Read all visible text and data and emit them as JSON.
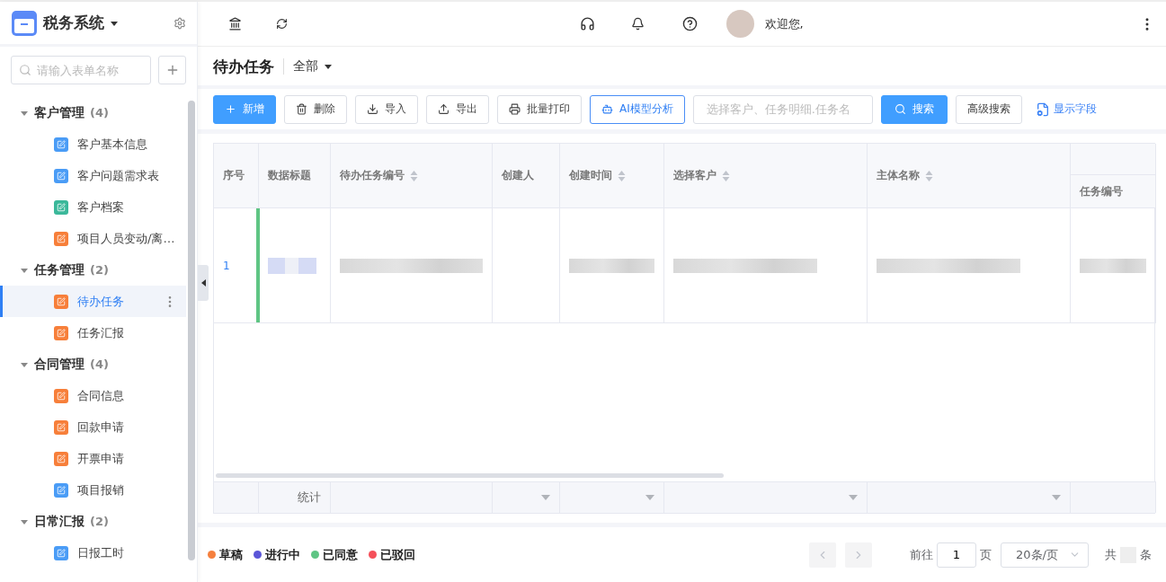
{
  "app": {
    "title": "税务系统"
  },
  "sidebar": {
    "search": {
      "placeholder": "请输入表单名称"
    },
    "groups": [
      {
        "label": "客户管理",
        "count": "(4)",
        "expanded": true,
        "children": [
          {
            "label": "客户基本信息",
            "color": "#4a9cf6",
            "selected": false
          },
          {
            "label": "客户问题需求表",
            "color": "#4a9cf6",
            "selected": false
          },
          {
            "label": "客户档案",
            "color": "#3bb89a",
            "selected": false
          },
          {
            "label": "项目人员变动/离…",
            "color": "#f77f3a",
            "selected": false
          }
        ]
      },
      {
        "label": "任务管理",
        "count": "(2)",
        "expanded": true,
        "children": [
          {
            "label": "待办任务",
            "color": "#f77f3a",
            "selected": true
          },
          {
            "label": "任务汇报",
            "color": "#f77f3a",
            "selected": false
          }
        ]
      },
      {
        "label": "合同管理",
        "count": "(4)",
        "expanded": true,
        "children": [
          {
            "label": "合同信息",
            "color": "#f77f3a",
            "selected": false
          },
          {
            "label": "回款申请",
            "color": "#f77f3a",
            "selected": false
          },
          {
            "label": "开票申请",
            "color": "#f77f3a",
            "selected": false
          },
          {
            "label": "项目报销",
            "color": "#4a9cf6",
            "selected": false
          }
        ]
      },
      {
        "label": "日常汇报",
        "count": "(2)",
        "expanded": true,
        "children": [
          {
            "label": "日报工时",
            "color": "#4a9cf6",
            "selected": false
          }
        ]
      }
    ]
  },
  "topbar": {
    "welcome": "欢迎您,"
  },
  "page": {
    "title": "待办任务",
    "filter": "全部"
  },
  "toolbar": {
    "buttons": [
      {
        "label": "新增",
        "kind": "primary"
      },
      {
        "label": "删除",
        "kind": "default"
      },
      {
        "label": "导入",
        "kind": "default"
      },
      {
        "label": "导出",
        "kind": "default"
      },
      {
        "label": "批量打印",
        "kind": "default"
      },
      {
        "label": "AI模型分析",
        "kind": "outline"
      }
    ],
    "search": {
      "placeholder": "选择客户、任务明细.任务名"
    },
    "search_button": "搜索",
    "advanced_button": "高级搜索",
    "fields_link": "显示字段"
  },
  "table": {
    "columns": [
      {
        "label": "序号",
        "sortable": false,
        "kind": "plain"
      },
      {
        "label": "数据标题",
        "sortable": false,
        "kind": "plain"
      },
      {
        "label": "待办任务编号",
        "sortable": true,
        "kind": "plain"
      },
      {
        "label": "创建人",
        "sortable": false,
        "kind": "plain"
      },
      {
        "label": "创建时间",
        "sortable": true,
        "kind": "plain"
      },
      {
        "label": "选择客户",
        "sortable": true,
        "kind": "plain"
      },
      {
        "label": "主体名称",
        "sortable": true,
        "kind": "plain"
      },
      {
        "label": "任务编号",
        "sortable": false,
        "kind": "sub"
      }
    ],
    "rows": [
      {
        "color": "#5fc584",
        "cells": [
          {
            "kind": "text",
            "text": "1"
          },
          {
            "kind": "tag"
          },
          {
            "kind": "blur"
          },
          {
            "kind": "empty"
          },
          {
            "kind": "blur"
          },
          {
            "kind": "blur"
          },
          {
            "kind": "blur"
          },
          {
            "kind": "blur"
          }
        ]
      }
    ],
    "summary": [
      {
        "kind": "empty"
      },
      {
        "kind": "label",
        "text": "统计"
      },
      {
        "kind": "empty"
      },
      {
        "kind": "dropdown"
      },
      {
        "kind": "dropdown"
      },
      {
        "kind": "dropdown"
      },
      {
        "kind": "dropdown"
      },
      {
        "kind": "empty"
      }
    ]
  },
  "legend": [
    {
      "label": "草稿",
      "color": "#f5803e"
    },
    {
      "label": "进行中",
      "color": "#5a55d8"
    },
    {
      "label": "已同意",
      "color": "#5fc584"
    },
    {
      "label": "已驳回",
      "color": "#f5505a"
    }
  ],
  "pagination": {
    "goto": "前往",
    "page": "1",
    "page_unit": "页",
    "page_size": "20条/页",
    "total_prefix": "共",
    "total_suffix": "条"
  }
}
